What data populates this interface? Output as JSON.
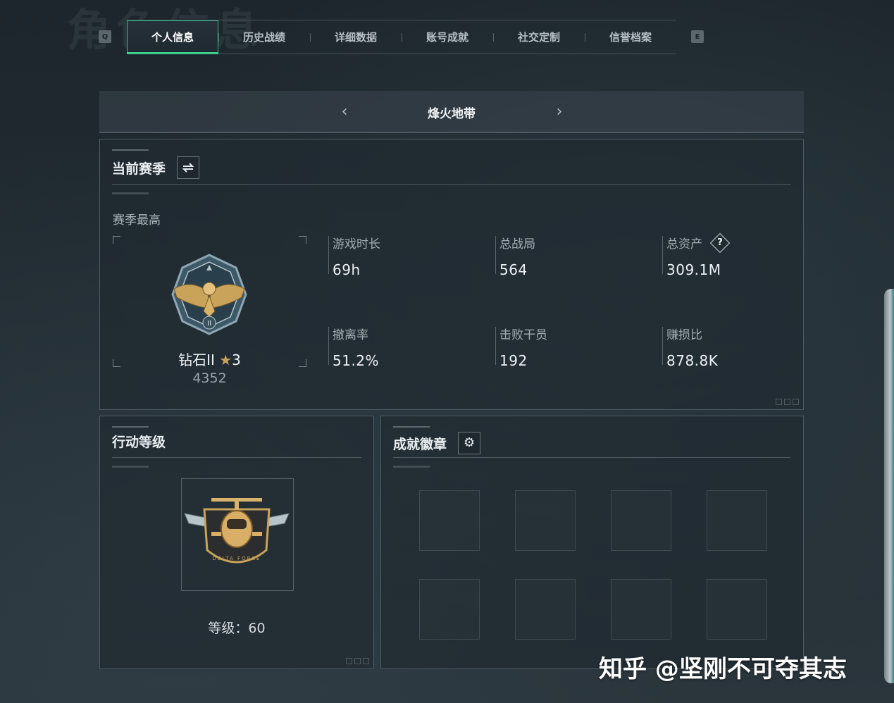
{
  "bg_title": "角色信息",
  "nav": {
    "left_key": "Q",
    "right_key": "E",
    "tabs": [
      {
        "label": "个人信息",
        "active": true
      },
      {
        "label": "历史战绩",
        "active": false
      },
      {
        "label": "详细数据",
        "active": false
      },
      {
        "label": "账号成就",
        "active": false
      },
      {
        "label": "社交定制",
        "active": false
      },
      {
        "label": "信誉档案",
        "active": false
      }
    ]
  },
  "mode": {
    "title": "烽火地带",
    "prev": "‹",
    "next": "›"
  },
  "season": {
    "title": "当前赛季",
    "switch_icon": "swap-icon",
    "best_label": "赛季最高",
    "rank_name": "钻石II",
    "rank_stars": "3",
    "rank_points": "4352",
    "stats": [
      {
        "label": "游戏时长",
        "value": "69h"
      },
      {
        "label": "总战局",
        "value": "564"
      },
      {
        "label": "总资产",
        "value": "309.1M"
      },
      {
        "label": "撤离率",
        "value": "51.2%"
      },
      {
        "label": "击败干员",
        "value": "192"
      },
      {
        "label": "赚损比",
        "value": "878.8K"
      }
    ]
  },
  "level": {
    "title": "行动等级",
    "label": "等级：60",
    "badge_text": "DELTA FORCE"
  },
  "badges": {
    "title": "成就徽章",
    "settings_icon": "gear-icon"
  },
  "watermark": "知乎 @坚刚不可夺其志",
  "colors": {
    "accent": "#3ccf8e",
    "gold": "#c9a35a",
    "panel_bg": "#202a30"
  }
}
